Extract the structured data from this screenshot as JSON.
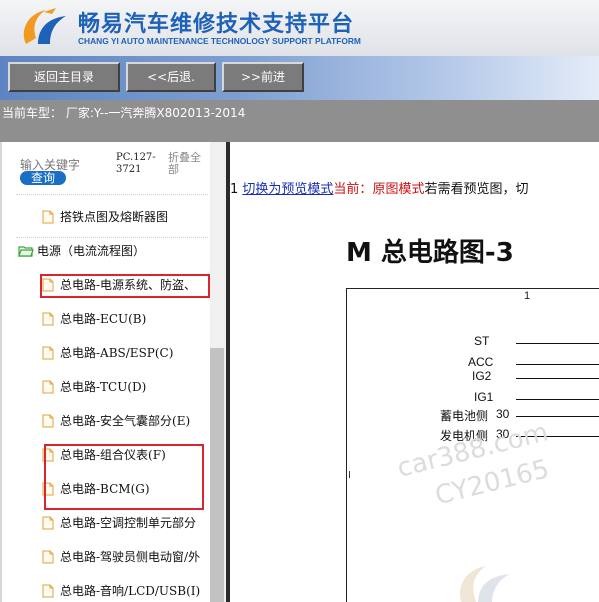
{
  "header": {
    "title": "畅易汽车维修技术支持平台",
    "subtitle": "CHANG YI AUTO MAINTENANCE TECHNOLOGY SUPPORT PLATFORM",
    "brand_color": "#1e62b8",
    "accent_color": "#f29a1f"
  },
  "nav": {
    "home": "返回主目录",
    "back": "<<后退.",
    "forward": ">>前进"
  },
  "vehicle": {
    "current": "当前车型：  厂家:Y--一汽奔腾X802013-2014"
  },
  "sidebar": {
    "search_hint": "输入关键字",
    "search_button": "查询",
    "pc_code": "PC.127-3721",
    "collapse_all": "折叠全部",
    "items": [
      {
        "label": "搭铁点图及熔断器图",
        "type": "doc"
      },
      {
        "label": "电源（电流流程图）",
        "type": "folder"
      },
      {
        "label": "总电路-电源系统、防盗、",
        "type": "doc",
        "highlighted": true
      },
      {
        "label": "总电路-ECU(B)",
        "type": "doc"
      },
      {
        "label": "总电路-ABS/ESP(C)",
        "type": "doc"
      },
      {
        "label": "总电路-TCU(D)",
        "type": "doc"
      },
      {
        "label": "总电路-安全气囊部分(E)",
        "type": "doc"
      },
      {
        "label": "总电路-组合仪表(F)",
        "type": "doc",
        "highlighted": true
      },
      {
        "label": "总电路-BCM(G)",
        "type": "doc",
        "highlighted": true
      },
      {
        "label": "总电路-空调控制单元部分",
        "type": "doc"
      },
      {
        "label": "总电路-驾驶员侧电动窗/外",
        "type": "doc"
      },
      {
        "label": "总电路-音响/LCD/USB(I)",
        "type": "doc"
      }
    ],
    "highlight_color": "#d9252d"
  },
  "main": {
    "mode_prefix": "1 ",
    "switch_link": "切换为预览模式",
    "current_label": "当前：",
    "current_mode": "原图模式",
    "hint": "若需看预览图，切",
    "diagram_title": "M  总电路图-3",
    "column_number": "1",
    "signals": [
      {
        "label": "ST",
        "pin": ""
      },
      {
        "label": "ACC",
        "pin": ""
      },
      {
        "label": "IG2",
        "pin": ""
      },
      {
        "label": "IG1",
        "pin": ""
      },
      {
        "label": "蓄电池侧",
        "pin": "30"
      },
      {
        "label": "发电机侧",
        "pin": "30"
      }
    ],
    "tick_label": "I",
    "watermark_line1": "car388.com",
    "watermark_line2": "CY20165"
  }
}
